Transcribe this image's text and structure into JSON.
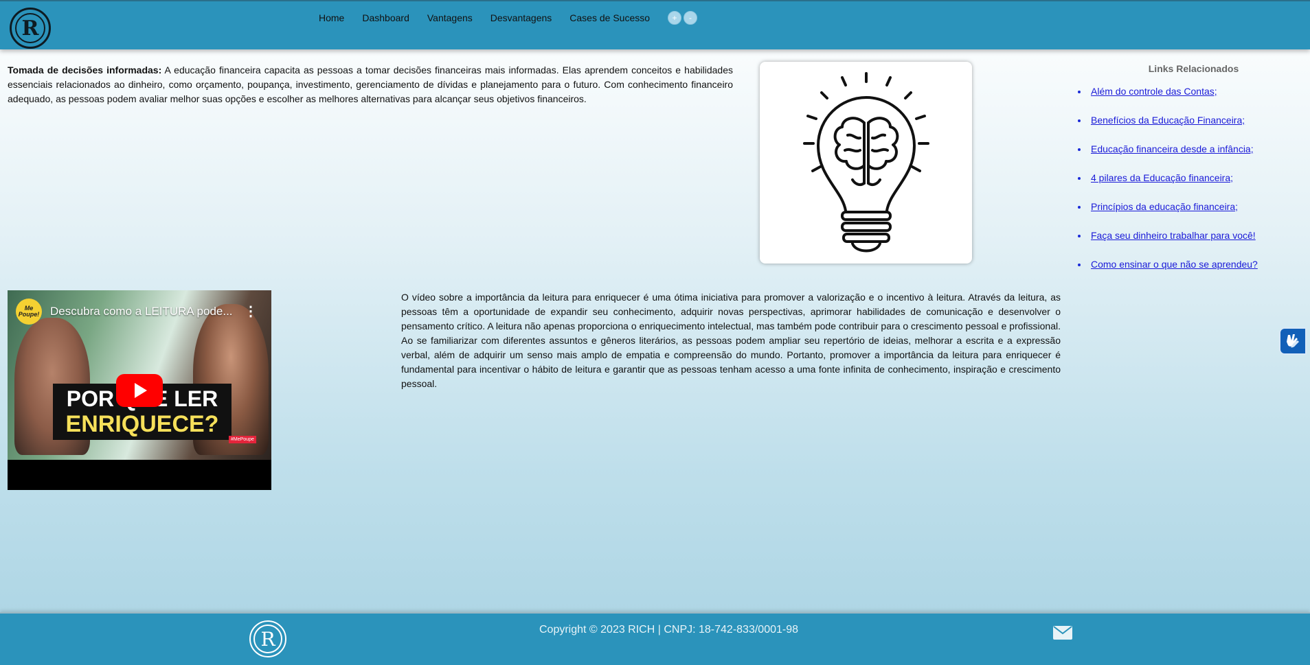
{
  "header": {
    "logo_letter": "R",
    "nav": [
      "Home",
      "Dashboard",
      "Vantagens",
      "Desvantagens",
      "Cases de Sucesso"
    ],
    "zoom_in": "+",
    "zoom_out": "-"
  },
  "intro": {
    "bold": "Tomada de decisões informadas:",
    "text": " A educação financeira capacita as pessoas a tomar decisões financeiras mais informadas. Elas aprendem conceitos e habilidades essenciais relacionados ao dinheiro, como orçamento, poupança, investimento, gerenciamento de dívidas e planejamento para o futuro. Com conhecimento financeiro adequado, as pessoas podem avaliar melhor suas opções e escolher as melhores alternativas para alcançar seus objetivos financeiros."
  },
  "related": {
    "title": "Links Relacionados",
    "links": [
      "Além do controle das Contas;",
      "Benefícios da Educação Financeira;",
      "Educação financeira desde a infância;",
      "4 pilares da Educação financeira;",
      "Princípios da educação financeira;",
      "Faça seu dinheiro trabalhar para você!",
      "Como ensinar o que não se aprendeu?"
    ]
  },
  "video": {
    "channel": "Me Poupe!",
    "title": "Descubra como a LEITURA pode...",
    "caption_line1": "POR QUE LER",
    "caption_line2": "ENRIQUECE?",
    "badge": "#MePoupe"
  },
  "article": {
    "text": "O vídeo sobre a importância da leitura para enriquecer é uma ótima iniciativa para promover a valorização e o incentivo à leitura. Através da leitura, as pessoas têm a oportunidade de expandir seu conhecimento, adquirir novas perspectivas, aprimorar habilidades de comunicação e desenvolver o pensamento crítico. A leitura não apenas proporciona o enriquecimento intelectual, mas também pode contribuir para o crescimento pessoal e profissional. Ao se familiarizar com diferentes assuntos e gêneros literários, as pessoas podem ampliar seu repertório de ideias, melhorar a escrita e a expressão verbal, além de adquirir um senso mais amplo de empatia e compreensão do mundo. Portanto, promover a importância da leitura para enriquecer é fundamental para incentivar o hábito de leitura e garantir que as pessoas tenham acesso a uma fonte infinita de conhecimento, inspiração e crescimento pessoal."
  },
  "footer": {
    "logo_letter": "R",
    "copyright": "Copyright © 2023 RICH | CNPJ: 18-742-833/0001-98"
  },
  "icons": {
    "bulb": "lightbulb-brain-icon",
    "a11y": "sign-language-icon",
    "mail": "envelope-icon"
  },
  "colors": {
    "header_bg": "#2b93bb",
    "link": "#1a1ad8",
    "play": "#ff0000"
  }
}
